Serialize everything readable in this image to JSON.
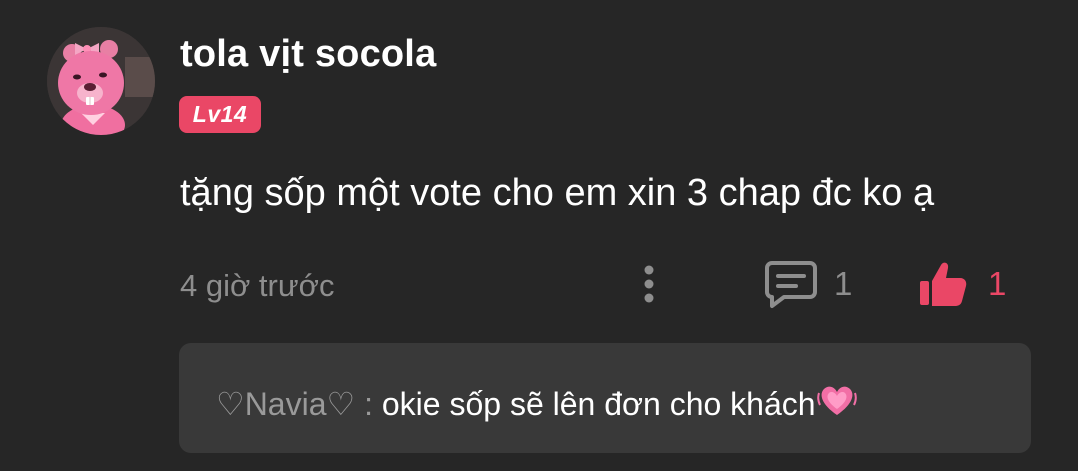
{
  "comment": {
    "username": "tola vịt socola",
    "level": "Lv14",
    "text": "tặng sốp một vote cho em xin 3 chap đc ko ạ",
    "timestamp": "4 giờ trước",
    "reply_count": "1",
    "like_count": "1"
  },
  "reply": {
    "author": "♡Navia♡",
    "separator": " : ",
    "message": "okie sốp sẽ lên đơn cho khách"
  },
  "icons": {
    "avatar": "pink-beaver-avatar",
    "more": "vertical-dots-icon",
    "reply": "comment-bubble-icon",
    "like": "thumbs-up-icon",
    "emoji": "beating-heart-emoji"
  },
  "colors": {
    "background": "#262626",
    "accent": "#ea4766",
    "muted": "#8e8e8e",
    "reply_box": "#393939"
  }
}
